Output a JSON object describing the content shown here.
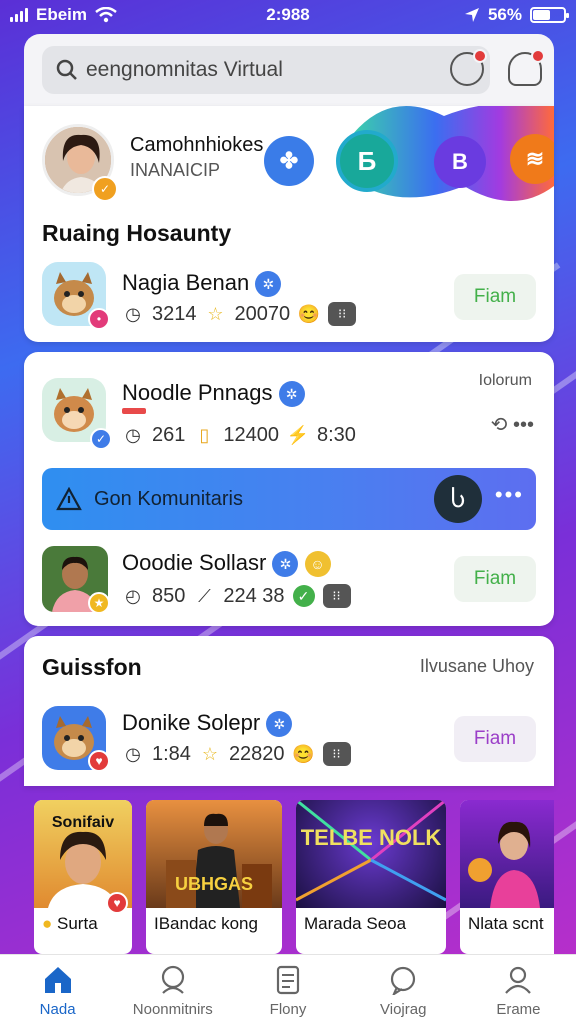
{
  "status_bar": {
    "carrier": "Ebeim",
    "time": "2:988",
    "battery": "56%",
    "battery_level": 0.56
  },
  "search": {
    "value": "eengnomnitas Virtual"
  },
  "featured": {
    "user_name": "Camohnhiokes",
    "user_sub": "INANAICIP",
    "circle_labels": [
      "Б",
      "В"
    ]
  },
  "section1": {
    "title": "Ruaing Hosaunty",
    "row": {
      "name": "Nagia Benan",
      "stat1": "3214",
      "stat2": "20070",
      "join_label": "Fiam"
    }
  },
  "card2": {
    "corner_label": "Iolorum",
    "row1": {
      "name": "Noodle Pnnags",
      "stat1": "261",
      "stat2": "12400",
      "stat3": "8:30"
    },
    "cta_label": "Gon Komunitaris",
    "row2": {
      "name": "Ooodie Sollasr",
      "stat1": "850",
      "stat2": "224 38",
      "join_label": "Fiam"
    }
  },
  "section3": {
    "title": "Guissfon",
    "link": "Ilvusane Uhoy",
    "row": {
      "name": "Donike Solepr",
      "stat1": "1:84",
      "stat2": "22820",
      "join_label": "Fiam"
    }
  },
  "media": [
    {
      "caption": "Surta",
      "overlay": "Sonifaiv"
    },
    {
      "caption": "IBandac kong",
      "overlay": "UBHGAS"
    },
    {
      "caption": "Marada Seoa",
      "overlay": "TELBE NOLK"
    },
    {
      "caption": "Nlata scnt",
      "overlay": ""
    }
  ],
  "nav": [
    {
      "label": "Nada",
      "icon": "home-icon",
      "active": true
    },
    {
      "label": "Noonmitnirs",
      "icon": "community-icon",
      "active": false
    },
    {
      "label": "Flony",
      "icon": "document-icon",
      "active": false
    },
    {
      "label": "Viojrag",
      "icon": "chat-icon",
      "active": false
    },
    {
      "label": "Erame",
      "icon": "profile-icon",
      "active": false
    }
  ],
  "colors": {
    "accent": "#1a66c8",
    "join_green": "#43b04a",
    "join_purple": "#9b3fc8"
  }
}
